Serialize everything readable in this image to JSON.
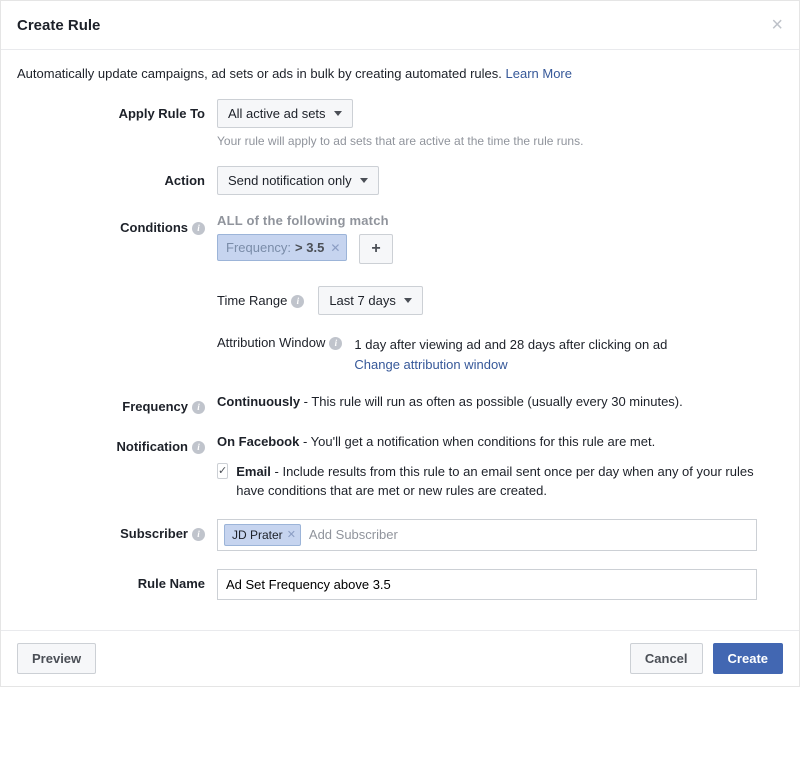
{
  "header": {
    "title": "Create Rule"
  },
  "intro": {
    "text": "Automatically update campaigns, ad sets or ads in bulk by creating automated rules. ",
    "learn_more": "Learn More"
  },
  "labels": {
    "apply_rule_to": "Apply Rule To",
    "action": "Action",
    "conditions": "Conditions",
    "time_range": "Time Range",
    "attribution_window": "Attribution Window",
    "frequency": "Frequency",
    "notification": "Notification",
    "subscriber": "Subscriber",
    "rule_name": "Rule Name"
  },
  "apply_rule": {
    "value": "All active ad sets",
    "help": "Your rule will apply to ad sets that are active at the time the rule runs."
  },
  "action": {
    "value": "Send notification only"
  },
  "conditions": {
    "head": "ALL of the following match",
    "chip_key": "Frequency:",
    "chip_val": "> 3.5",
    "time_range_value": "Last 7 days",
    "attr_text": "1 day after viewing ad and 28 days after clicking on ad",
    "attr_link": "Change attribution window"
  },
  "frequency": {
    "bold": "Continuously",
    "rest": " - This rule will run as often as possible (usually every 30 minutes)."
  },
  "notification": {
    "fb_bold": "On Facebook",
    "fb_rest": " - You'll get a notification when conditions for this rule are met.",
    "email_bold": "Email",
    "email_rest": " - Include results from this rule to an email sent once per day when any of your rules have conditions that are met or new rules are created."
  },
  "subscriber": {
    "token": "JD Prater",
    "placeholder": "Add Subscriber"
  },
  "rule_name": {
    "value": "Ad Set Frequency above 3.5"
  },
  "footer": {
    "preview": "Preview",
    "cancel": "Cancel",
    "create": "Create"
  }
}
